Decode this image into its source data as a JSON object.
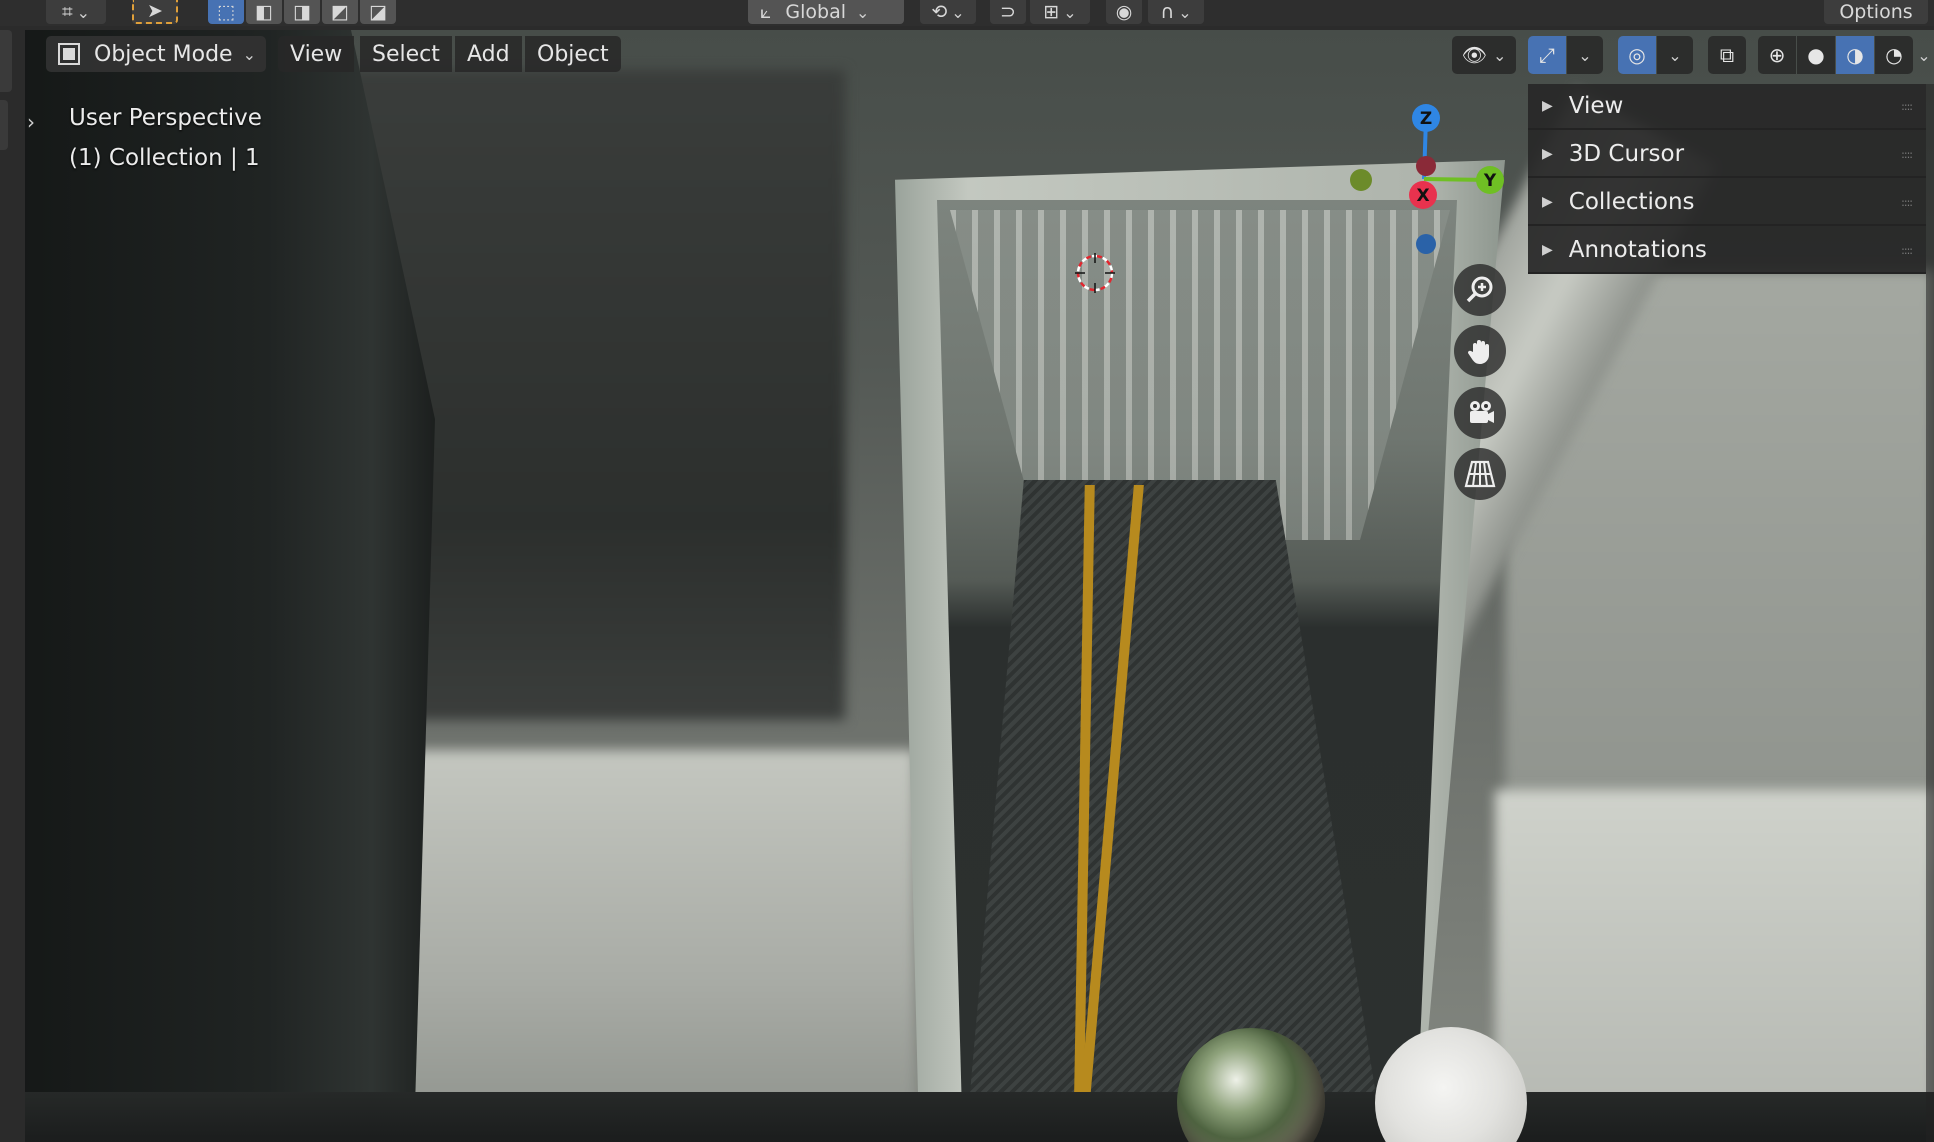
{
  "top_header": {
    "transform_orientation": "Global",
    "options_label": "Options"
  },
  "header": {
    "mode": "Object Mode",
    "menus": [
      "View",
      "Select",
      "Add",
      "Object"
    ]
  },
  "viewport_overlay": {
    "view_name": "User Perspective",
    "collection_info": "(1) Collection | 1"
  },
  "gizmo": {
    "axes": [
      "Z",
      "Y",
      "X"
    ],
    "colors": {
      "x": "#e8324e",
      "y": "#6fbf24",
      "z": "#2f86e4",
      "x_neg": "#8a2a38",
      "y_neg": "#6c8b2a",
      "z_neg": "#2a62a8"
    }
  },
  "nav_buttons": [
    "zoom-icon",
    "hand-pan-icon",
    "camera-icon",
    "grid-ortho-icon"
  ],
  "sidebar": {
    "panels": [
      "View",
      "3D Cursor",
      "Collections",
      "Annotations"
    ]
  },
  "colors": {
    "accent": "#4772b3",
    "select_highlight": "#e0a03a",
    "panel_bg": "#282828"
  }
}
